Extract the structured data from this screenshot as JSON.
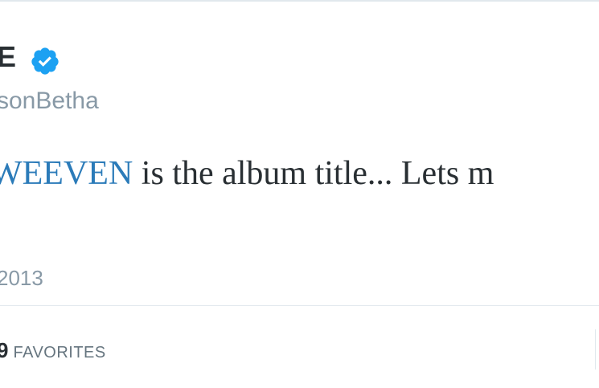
{
  "tweet": {
    "display_name": "E",
    "handle": "sonBetha",
    "text_hashtag": "WEEVEN",
    "text_rest": " is the album title... Lets m",
    "timestamp": "2013",
    "favorites_count": "9",
    "favorites_label": "FAVORITES",
    "verified_icon": "verified-badge-icon"
  },
  "colors": {
    "verified": "#1da1f2",
    "hashtag": "#2b7bb9",
    "muted": "#8899a6"
  }
}
